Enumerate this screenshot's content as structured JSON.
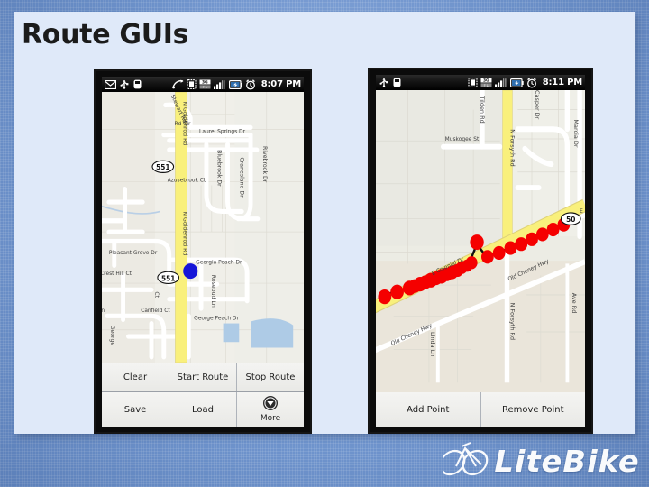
{
  "slide": {
    "title": "Route GUIs",
    "background_color": "#7fa0d6",
    "panel_color": "#dfe9f9"
  },
  "branding": {
    "logo_text": "LiteBike",
    "logo_icon": "bicycle-icon"
  },
  "phones": [
    {
      "id": "phone-left",
      "status_bar": {
        "time": "8:07 PM",
        "left_icons": [
          "gmail-icon",
          "usb-icon",
          "android-icon"
        ],
        "right_icons": [
          "sync-icon",
          "sd-card-icon",
          "3g-icon",
          "signal-bars-icon",
          "battery-charging-icon",
          "alarm-clock-icon"
        ]
      },
      "map": {
        "provider_style": "google-maps",
        "my_location_marker": "blue-dot",
        "highway_shields": [
          "551",
          "551"
        ],
        "labels": [
          "N Goldenrod Rd",
          "N Goldenrod Rd",
          "Stewart Rd Cir",
          "Laurel Springs Dr",
          "Bluebrook Dr",
          "Cranesland Dr",
          "Rivebrook Dr",
          "Azusebrook Ct",
          "Pleasant Grove Dr",
          "Crest Hill Ct",
          "Georgia Peach Dr",
          "Georgia Peach Dr",
          "Rosebud Ln",
          "Canfield Ct",
          "George Ln"
        ]
      },
      "buttons": [
        {
          "label": "Clear",
          "icon": null
        },
        {
          "label": "Start Route",
          "icon": null
        },
        {
          "label": "Stop Route",
          "icon": null
        },
        {
          "label": "Save",
          "icon": null
        },
        {
          "label": "Load",
          "icon": null
        },
        {
          "label": "More",
          "icon": "chevron-down-circle-icon"
        }
      ]
    },
    {
      "id": "phone-right",
      "status_bar": {
        "time": "8:11 PM",
        "left_icons": [
          "usb-icon",
          "android-icon"
        ],
        "right_icons": [
          "sd-card-icon",
          "3g-icon",
          "signal-bars-icon",
          "battery-charging-icon",
          "alarm-clock-icon"
        ]
      },
      "map": {
        "provider_style": "google-maps",
        "route_marker_color": "#f00000",
        "route_marker_count": 24,
        "highway_shields": [
          "50"
        ],
        "labels": [
          "Muskogee St",
          "Tilden Rd",
          "N Forsyth Rd",
          "N Forsyth Rd",
          "Casper Dr",
          "Marcia Dr",
          "E Colonial Dr",
          "Old Cheney Hwy",
          "Old Cheney Hwy",
          "Linda Ln",
          "Ave Rd",
          "E"
        ]
      },
      "buttons": [
        {
          "label": "Add Point",
          "icon": null
        },
        {
          "label": "Remove Point",
          "icon": null
        }
      ]
    }
  ]
}
